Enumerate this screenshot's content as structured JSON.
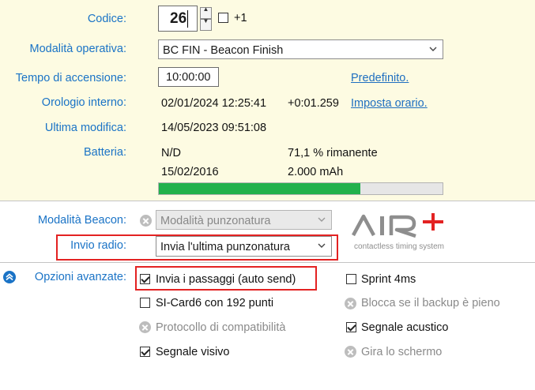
{
  "labels": {
    "codice": "Codice:",
    "modalita_operativa": "Modalità operativa:",
    "tempo_accensione": "Tempo di accensione:",
    "orologio_interno": "Orologio interno:",
    "ultima_modifica": "Ultima modifica:",
    "batteria": "Batteria:",
    "modalita_beacon": "Modalità Beacon:",
    "invio_radio": "Invio radio:",
    "opzioni_avanzate": "Opzioni avanzate:"
  },
  "codice": {
    "value": "26",
    "plus_one_label": "+1",
    "plus_one_checked": false
  },
  "modalita_operativa": {
    "selected": "BC FIN - Beacon Finish"
  },
  "tempo_accensione": {
    "value": "10:00:00",
    "default_link": "Predefinito."
  },
  "orologio": {
    "datetime": "02/01/2024 12:25:41",
    "offset": "+0:01.259",
    "set_link": "Imposta orario."
  },
  "ultima_modifica": {
    "datetime": "14/05/2023 09:51:08"
  },
  "batteria": {
    "status": "N/D",
    "remaining": "71,1 % rimanente",
    "date": "15/02/2016",
    "capacity": "2.000 mAh",
    "level_percent": 71.1
  },
  "modalita_beacon": {
    "selected": "Modalità punzonatura",
    "disabled": true
  },
  "invio_radio": {
    "selected": "Invia l'ultima punzonatura"
  },
  "logo": {
    "text": "AIR+",
    "tagline": "contactless timing system"
  },
  "opzioni": [
    {
      "label": "Invia i passaggi (auto send)",
      "state": "checked"
    },
    {
      "label": "Sprint 4ms",
      "state": "unchecked"
    },
    {
      "label": "SI-Card6 con 192 punti",
      "state": "unchecked"
    },
    {
      "label": "Blocca se il backup è pieno",
      "state": "disabled"
    },
    {
      "label": "Protocollo di compatibilità",
      "state": "disabled"
    },
    {
      "label": "Segnale acustico",
      "state": "checked"
    },
    {
      "label": "Segnale visivo",
      "state": "checked"
    },
    {
      "label": "Gira lo schermo",
      "state": "disabled"
    }
  ],
  "colors": {
    "label_blue": "#1a73c6",
    "panel_bg": "#fdfbe2",
    "battery_green": "#22b14c",
    "highlight_red": "#e32222"
  }
}
